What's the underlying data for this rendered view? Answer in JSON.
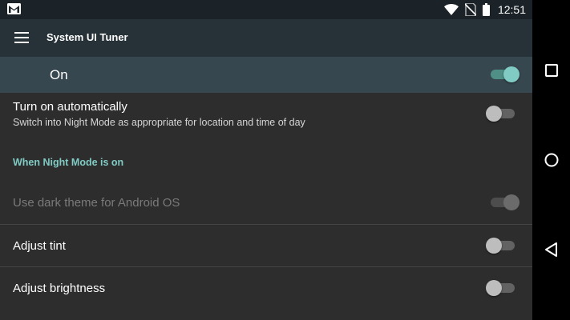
{
  "status_bar": {
    "time": "12:51",
    "icons": [
      "gmail-notification-icon",
      "wifi-icon",
      "no-sim-icon",
      "battery-icon"
    ]
  },
  "toolbar": {
    "title": "System UI Tuner",
    "menu_icon": "hamburger-menu-icon"
  },
  "master_switch": {
    "label": "On",
    "checked": true
  },
  "preferences": {
    "auto": {
      "title": "Turn on automatically",
      "summary": "Switch into Night Mode as appropriate for location and time of day",
      "checked": false
    },
    "category": "When Night Mode is on",
    "dark_theme": {
      "title": "Use dark theme for Android OS",
      "checked": true,
      "enabled": false
    },
    "tint": {
      "title": "Adjust tint",
      "checked": false
    },
    "brightness": {
      "title": "Adjust brightness",
      "checked": false
    }
  },
  "nav_bar": {
    "buttons": [
      "recents-icon",
      "home-icon",
      "back-icon"
    ]
  },
  "colors": {
    "accent": "#80cbc4",
    "toolbar": "#263238",
    "master_bar": "#37474f",
    "background": "#2d2d2d"
  }
}
